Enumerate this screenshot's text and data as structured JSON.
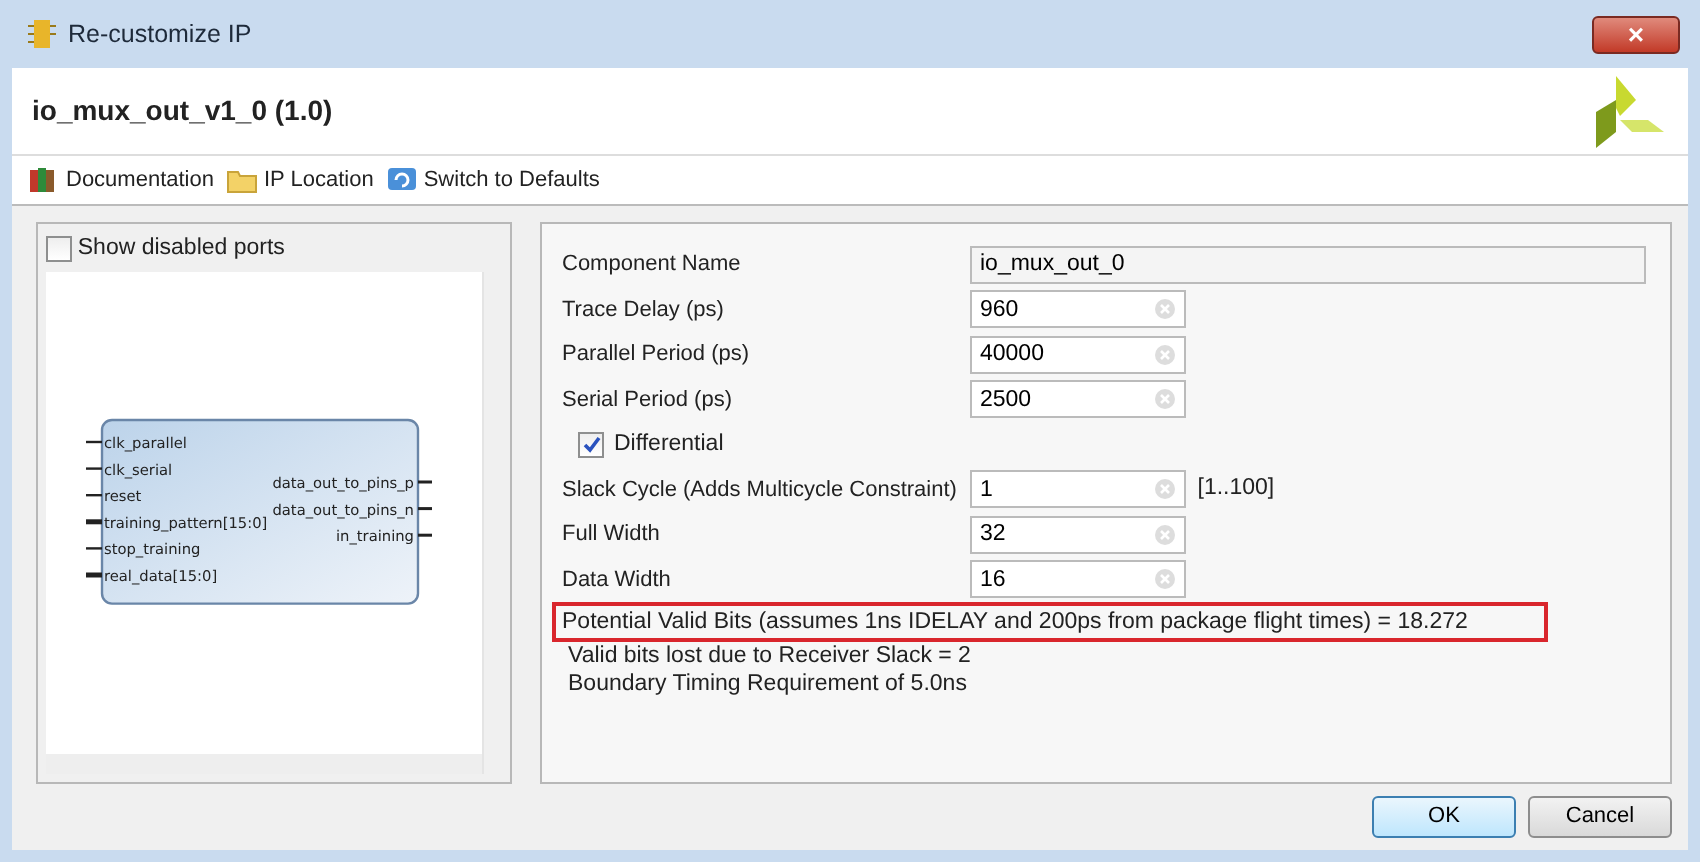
{
  "window": {
    "title": "Re-customize IP",
    "close": "×"
  },
  "header": {
    "title": "io_mux_out_v1_0 (1.0)"
  },
  "toolbar": [
    {
      "label": "Documentation",
      "kind": "book"
    },
    {
      "label": "IP Location",
      "kind": "folder"
    },
    {
      "label": "Switch to Defaults",
      "kind": "refresh"
    }
  ],
  "symbol_panel": {
    "show_disabled_ports": {
      "label": "Show disabled ports",
      "checked": false
    },
    "inputs": [
      {
        "name": "clk_parallel",
        "bus": false
      },
      {
        "name": "clk_serial",
        "bus": false
      },
      {
        "name": "reset",
        "bus": false
      },
      {
        "name": "training_pattern[15:0]",
        "bus": true
      },
      {
        "name": "stop_training",
        "bus": false
      },
      {
        "name": "real_data[15:0]",
        "bus": true
      }
    ],
    "outputs": [
      {
        "name": "data_out_to_pins_p"
      },
      {
        "name": "data_out_to_pins_n"
      },
      {
        "name": "in_training"
      }
    ]
  },
  "parameters": [
    {
      "kind": "readonly",
      "label": "Component Name",
      "value": "io_mux_out_0"
    },
    {
      "kind": "field",
      "label": "Trace Delay (ps)",
      "value": "960"
    },
    {
      "kind": "field",
      "label": "Parallel Period (ps)",
      "value": "40000"
    },
    {
      "kind": "field",
      "label": "Serial Period (ps)",
      "value": "2500"
    },
    {
      "kind": "checkbox",
      "label": "Differential",
      "checked": true
    },
    {
      "kind": "field",
      "label": "Slack Cycle (Adds Multicycle Constraint)",
      "value": "1",
      "range": "[1..100]"
    },
    {
      "kind": "field",
      "label": "Full Width",
      "value": "32"
    },
    {
      "kind": "field",
      "label": "Data Width",
      "value": "16"
    }
  ],
  "info_lines": [
    {
      "text": "Potential Valid Bits (assumes 1ns IDELAY and 200ps from package flight times) = 18.272",
      "highlighted": true
    },
    {
      "text": "Valid bits lost due to Receiver Slack = 2",
      "highlighted": false
    },
    {
      "text": "Boundary Timing Requirement of 5.0ns",
      "highlighted": false
    }
  ],
  "buttons": [
    {
      "label": "OK",
      "default": true
    },
    {
      "label": "Cancel",
      "default": false
    }
  ]
}
